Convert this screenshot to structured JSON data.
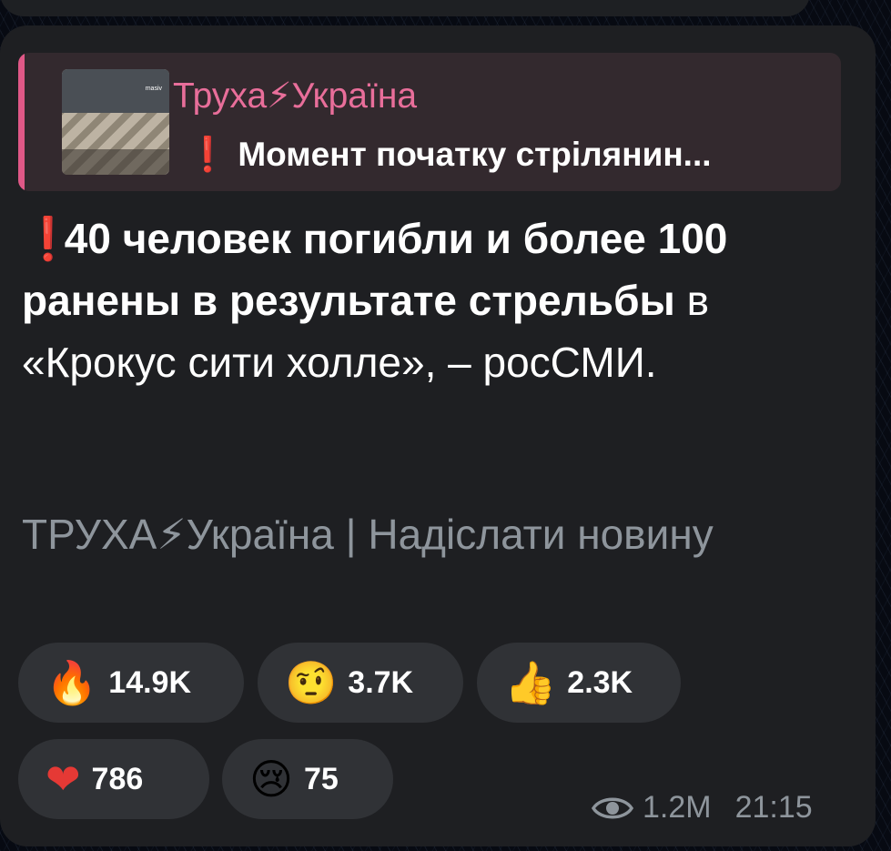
{
  "message": {
    "reply": {
      "channel": "Труха⚡Україна",
      "text": "❗ Момент початку стрілянин...",
      "thumb_tag": "masiv"
    },
    "body": {
      "prefix": "❗",
      "bold_part": "40 человек погибли и более 100 ранены в результате стрельбы",
      "regular_part": " в «Крокус сити холле», – росСМИ."
    },
    "signature": "ТРУХА⚡Україна | Надіслати новину",
    "reactions": [
      {
        "emoji": "🔥",
        "icon": "fire-icon",
        "count": "14.9K"
      },
      {
        "emoji": "🤨",
        "icon": "raised-eyebrow-face-icon",
        "count": "3.7K"
      },
      {
        "emoji": "👍",
        "icon": "thumbs-up-icon",
        "count": "2.3K"
      },
      {
        "emoji": "❤",
        "icon": "red-heart-icon",
        "count": "786"
      },
      {
        "emoji": "😢",
        "icon": "crying-face-icon",
        "count": "75"
      }
    ],
    "meta": {
      "views": "1.2M",
      "time": "21:15"
    }
  },
  "colors": {
    "bubble": "#1e1f22",
    "reply_accent": "#e05887",
    "reply_title": "#e86e9a",
    "muted_text": "#8e959c",
    "reaction_bg": "#303236"
  }
}
